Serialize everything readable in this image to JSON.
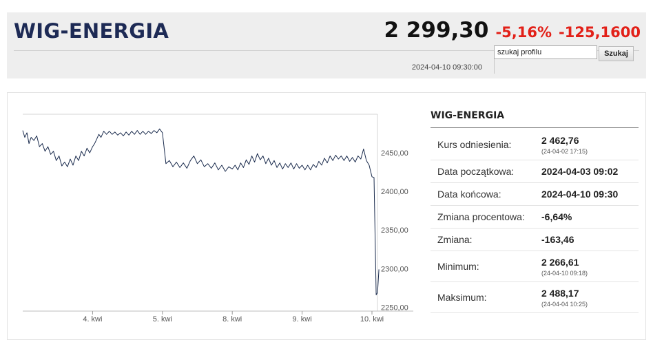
{
  "header": {
    "title": "WIG-ENERGIA",
    "value": "2 299,30",
    "change_pct": "-5,16%",
    "change_abs": "-125,1600",
    "timestamp": "2024-04-10 09:30:00",
    "search_value": "szukaj profilu",
    "search_button": "Szukaj"
  },
  "stats": {
    "title": "WIG-ENERGIA",
    "rows": [
      {
        "label": "Kurs odniesienia:",
        "value": "2 462,76",
        "sub": "(24-04-02 17:15)"
      },
      {
        "label": "Data początkowa:",
        "value": "2024-04-03 09:02"
      },
      {
        "label": "Data końcowa:",
        "value": "2024-04-10 09:30"
      },
      {
        "label": "Zmiana procentowa:",
        "value": "-6,64%"
      },
      {
        "label": "Zmiana:",
        "value": "-163,46"
      },
      {
        "label": "Minimum:",
        "value": "2 266,61",
        "sub": "(24-04-10 09:18)"
      },
      {
        "label": "Maksimum:",
        "value": "2 488,17",
        "sub": "(24-04-04 10:25)"
      }
    ]
  },
  "colors": {
    "line": "#1a2b4d",
    "negative": "#e22018",
    "title": "#1d2a55",
    "grid": "#e4e4e4"
  },
  "chart_data": {
    "type": "line",
    "title": "",
    "xlabel": "",
    "ylabel": "",
    "ylim": [
      2245,
      2500
    ],
    "grid": true,
    "x_tick_labels": [
      {
        "label": "4. kwi",
        "t": 1
      },
      {
        "label": "5. kwi",
        "t": 2
      },
      {
        "label": "8. kwi",
        "t": 3
      },
      {
        "label": "9. kwi",
        "t": 4
      },
      {
        "label": "10. kwi",
        "t": 5
      }
    ],
    "y_ticks": [
      {
        "value": 2450,
        "label": "2450,00"
      },
      {
        "value": 2400,
        "label": "2400,00"
      },
      {
        "value": 2350,
        "label": "2350,00"
      },
      {
        "value": 2300,
        "label": "2300,00"
      },
      {
        "value": 2250,
        "label": "2250,00"
      }
    ],
    "series": [
      {
        "points": [
          [
            0.0,
            2479
          ],
          [
            0.03,
            2470
          ],
          [
            0.06,
            2476
          ],
          [
            0.09,
            2462
          ],
          [
            0.12,
            2470
          ],
          [
            0.16,
            2466
          ],
          [
            0.2,
            2472
          ],
          [
            0.24,
            2458
          ],
          [
            0.28,
            2462
          ],
          [
            0.32,
            2452
          ],
          [
            0.36,
            2458
          ],
          [
            0.4,
            2448
          ],
          [
            0.44,
            2452
          ],
          [
            0.48,
            2440
          ],
          [
            0.52,
            2446
          ],
          [
            0.56,
            2433
          ],
          [
            0.6,
            2438
          ],
          [
            0.64,
            2432
          ],
          [
            0.68,
            2442
          ],
          [
            0.72,
            2434
          ],
          [
            0.76,
            2446
          ],
          [
            0.8,
            2440
          ],
          [
            0.84,
            2452
          ],
          [
            0.88,
            2446
          ],
          [
            0.92,
            2456
          ],
          [
            0.96,
            2450
          ],
          [
            1.0,
            2458
          ],
          [
            1.03,
            2462
          ],
          [
            1.06,
            2468
          ],
          [
            1.09,
            2474
          ],
          [
            1.12,
            2470
          ],
          [
            1.16,
            2478
          ],
          [
            1.2,
            2474
          ],
          [
            1.24,
            2478
          ],
          [
            1.28,
            2474
          ],
          [
            1.32,
            2477
          ],
          [
            1.36,
            2473
          ],
          [
            1.4,
            2476
          ],
          [
            1.44,
            2472
          ],
          [
            1.48,
            2477
          ],
          [
            1.52,
            2473
          ],
          [
            1.56,
            2478
          ],
          [
            1.6,
            2474
          ],
          [
            1.64,
            2479
          ],
          [
            1.68,
            2474
          ],
          [
            1.72,
            2478
          ],
          [
            1.76,
            2474
          ],
          [
            1.8,
            2478
          ],
          [
            1.84,
            2475
          ],
          [
            1.88,
            2479
          ],
          [
            1.92,
            2476
          ],
          [
            1.96,
            2481
          ],
          [
            2.0,
            2476
          ],
          [
            2.05,
            2436
          ],
          [
            2.1,
            2440
          ],
          [
            2.15,
            2432
          ],
          [
            2.2,
            2438
          ],
          [
            2.25,
            2431
          ],
          [
            2.3,
            2437
          ],
          [
            2.35,
            2430
          ],
          [
            2.4,
            2440
          ],
          [
            2.45,
            2446
          ],
          [
            2.5,
            2436
          ],
          [
            2.55,
            2441
          ],
          [
            2.6,
            2432
          ],
          [
            2.65,
            2436
          ],
          [
            2.7,
            2430
          ],
          [
            2.75,
            2437
          ],
          [
            2.8,
            2428
          ],
          [
            2.85,
            2434
          ],
          [
            2.9,
            2426
          ],
          [
            2.95,
            2432
          ],
          [
            3.0,
            2429
          ],
          [
            3.04,
            2434
          ],
          [
            3.08,
            2428
          ],
          [
            3.12,
            2437
          ],
          [
            3.16,
            2431
          ],
          [
            3.2,
            2441
          ],
          [
            3.24,
            2435
          ],
          [
            3.28,
            2446
          ],
          [
            3.32,
            2438
          ],
          [
            3.36,
            2449
          ],
          [
            3.4,
            2441
          ],
          [
            3.44,
            2446
          ],
          [
            3.48,
            2436
          ],
          [
            3.52,
            2443
          ],
          [
            3.56,
            2434
          ],
          [
            3.6,
            2440
          ],
          [
            3.64,
            2431
          ],
          [
            3.68,
            2437
          ],
          [
            3.72,
            2429
          ],
          [
            3.76,
            2436
          ],
          [
            3.8,
            2431
          ],
          [
            3.84,
            2437
          ],
          [
            3.88,
            2429
          ],
          [
            3.92,
            2436
          ],
          [
            3.96,
            2430
          ],
          [
            4.0,
            2434
          ],
          [
            4.04,
            2428
          ],
          [
            4.08,
            2434
          ],
          [
            4.12,
            2428
          ],
          [
            4.16,
            2435
          ],
          [
            4.2,
            2431
          ],
          [
            4.24,
            2439
          ],
          [
            4.28,
            2434
          ],
          [
            4.32,
            2443
          ],
          [
            4.36,
            2437
          ],
          [
            4.4,
            2446
          ],
          [
            4.44,
            2440
          ],
          [
            4.48,
            2447
          ],
          [
            4.52,
            2442
          ],
          [
            4.56,
            2446
          ],
          [
            4.6,
            2440
          ],
          [
            4.64,
            2446
          ],
          [
            4.68,
            2439
          ],
          [
            4.72,
            2444
          ],
          [
            4.76,
            2438
          ],
          [
            4.8,
            2446
          ],
          [
            4.84,
            2442
          ],
          [
            4.88,
            2455
          ],
          [
            4.92,
            2440
          ],
          [
            4.96,
            2434
          ],
          [
            5.0,
            2419
          ],
          [
            5.03,
            2418
          ],
          [
            5.06,
            2266
          ],
          [
            5.08,
            2269
          ],
          [
            5.1,
            2299
          ]
        ]
      }
    ]
  }
}
